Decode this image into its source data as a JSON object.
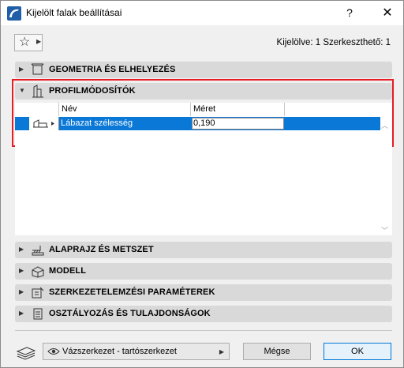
{
  "window": {
    "title": "Kijelölt falak beállításai",
    "help_label": "?",
    "close_label": "✕"
  },
  "header": {
    "selection_info": "Kijelölve: 1 Szerkeszthető: 1"
  },
  "panels": [
    {
      "label": "GEOMETRIA ÉS ELHELYEZÉS",
      "icon": "wall-geometry-icon",
      "expanded": false
    },
    {
      "label": "PROFILMÓDOSÍTÓK",
      "icon": "profile-modifier-icon",
      "expanded": true
    },
    {
      "label": "ALAPRAJZ ÉS METSZET",
      "icon": "floor-plan-section-icon",
      "expanded": false
    },
    {
      "label": "MODELL",
      "icon": "model-3d-icon",
      "expanded": false
    },
    {
      "label": "SZERKEZETELEMZÉSI PARAMÉTEREK",
      "icon": "structural-analysis-icon",
      "expanded": false
    },
    {
      "label": "OSZTÁLYOZÁS ÉS TULAJDONSÁGOK",
      "icon": "classification-icon",
      "expanded": false
    }
  ],
  "modifier_table": {
    "columns": [
      "Név",
      "Méret"
    ],
    "rows": [
      {
        "name": "Lábazat szélesség",
        "value": "0,190",
        "selected": true
      }
    ]
  },
  "footer": {
    "layer_dropdown": "Vázszerkezet - tartószerkezet",
    "cancel_label": "Mégse",
    "ok_label": "OK"
  },
  "colors": {
    "selection": "#0a78d7",
    "highlight_frame": "#e81c24",
    "panel_header": "#d9d9d9",
    "client_bg": "#f0f0f0"
  }
}
